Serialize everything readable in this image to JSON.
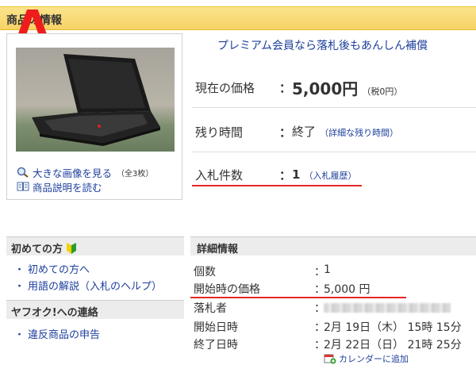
{
  "header": {
    "title": "商品の情報",
    "overlay_letter": "A"
  },
  "premium_text": "プレミアム会員なら落札後もあんしん補償",
  "image_links": {
    "enlarge": "大きな画像を見る",
    "count": "（全3枚）",
    "description": "商品説明を読む"
  },
  "summary": {
    "price": {
      "label": "現在の価格",
      "colon": "：",
      "value": "5,000円",
      "tax": "（税0円）"
    },
    "remaining": {
      "label": "残り時間",
      "colon": "：",
      "value": "終了",
      "link": "（詳細な残り時間）"
    },
    "bids": {
      "label": "入札件数",
      "colon": "：",
      "value": "1",
      "link": "（入札履歴）"
    }
  },
  "beginners": {
    "title": "初めての方",
    "items": [
      "初めての方へ",
      "用語の解説（入札のヘルプ）"
    ]
  },
  "contact": {
    "title": "ヤフオク!への連絡",
    "items": [
      "違反商品の申告"
    ]
  },
  "details": {
    "title": "詳細情報",
    "rows": [
      {
        "label": "個数",
        "colon": "：",
        "value": "1"
      },
      {
        "label": "開始時の価格",
        "colon": "：",
        "value": "5,000 円"
      },
      {
        "label": "落札者",
        "colon": "：",
        "value": ""
      },
      {
        "label": "開始日時",
        "colon": "：",
        "value": "2月 19日（木） 15時 15分"
      },
      {
        "label": "終了日時",
        "colon": "：",
        "value": "2月 22日（日） 21時 25分"
      }
    ],
    "calendar_link": "カレンダーに追加"
  },
  "colors": {
    "accent_red": "#e52727",
    "link_blue": "#1d3f9c",
    "header_yellow": "#f6d365"
  }
}
